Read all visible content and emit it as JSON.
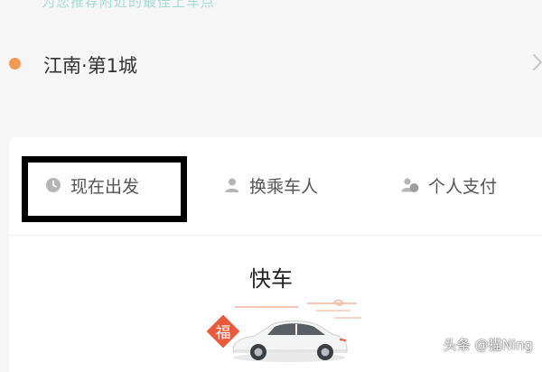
{
  "header": {
    "hint_text": "为您推荐附近的最佳上车点"
  },
  "location": {
    "label": "江南·第1城",
    "dot_color": "#f59a55",
    "chevron_icon": "chevron-right-icon"
  },
  "options": [
    {
      "label": "现在出发",
      "icon": "clock-icon"
    },
    {
      "label": "换乘车人",
      "icon": "person-icon"
    },
    {
      "label": "个人支付",
      "icon": "wallet-people-icon"
    }
  ],
  "ride": {
    "type_label": "快车",
    "badge_char": "福",
    "badge_color": "#e85a3a"
  },
  "watermark": {
    "text": "头条 @猫Ning"
  }
}
